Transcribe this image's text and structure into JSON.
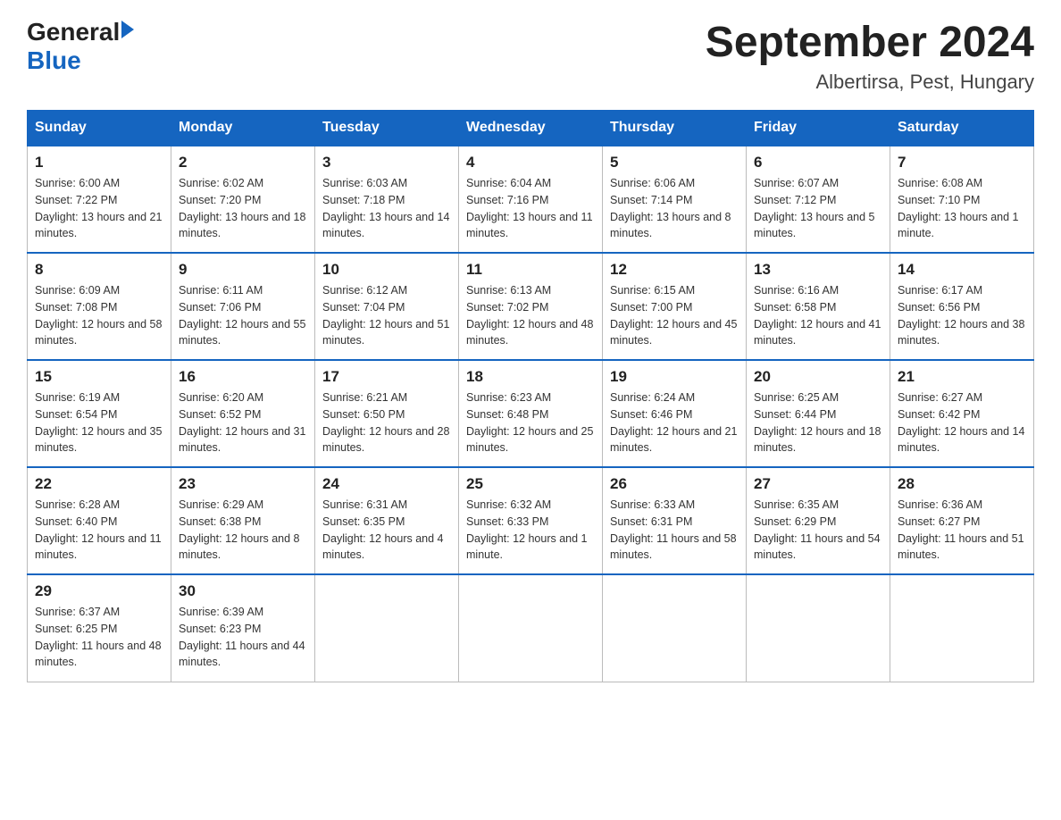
{
  "header": {
    "logo_general": "General",
    "logo_blue": "Blue",
    "title": "September 2024",
    "subtitle": "Albertirsa, Pest, Hungary"
  },
  "weekdays": [
    "Sunday",
    "Monday",
    "Tuesday",
    "Wednesday",
    "Thursday",
    "Friday",
    "Saturday"
  ],
  "weeks": [
    [
      {
        "day": "1",
        "sunrise": "6:00 AM",
        "sunset": "7:22 PM",
        "daylight": "13 hours and 21 minutes."
      },
      {
        "day": "2",
        "sunrise": "6:02 AM",
        "sunset": "7:20 PM",
        "daylight": "13 hours and 18 minutes."
      },
      {
        "day": "3",
        "sunrise": "6:03 AM",
        "sunset": "7:18 PM",
        "daylight": "13 hours and 14 minutes."
      },
      {
        "day": "4",
        "sunrise": "6:04 AM",
        "sunset": "7:16 PM",
        "daylight": "13 hours and 11 minutes."
      },
      {
        "day": "5",
        "sunrise": "6:06 AM",
        "sunset": "7:14 PM",
        "daylight": "13 hours and 8 minutes."
      },
      {
        "day": "6",
        "sunrise": "6:07 AM",
        "sunset": "7:12 PM",
        "daylight": "13 hours and 5 minutes."
      },
      {
        "day": "7",
        "sunrise": "6:08 AM",
        "sunset": "7:10 PM",
        "daylight": "13 hours and 1 minute."
      }
    ],
    [
      {
        "day": "8",
        "sunrise": "6:09 AM",
        "sunset": "7:08 PM",
        "daylight": "12 hours and 58 minutes."
      },
      {
        "day": "9",
        "sunrise": "6:11 AM",
        "sunset": "7:06 PM",
        "daylight": "12 hours and 55 minutes."
      },
      {
        "day": "10",
        "sunrise": "6:12 AM",
        "sunset": "7:04 PM",
        "daylight": "12 hours and 51 minutes."
      },
      {
        "day": "11",
        "sunrise": "6:13 AM",
        "sunset": "7:02 PM",
        "daylight": "12 hours and 48 minutes."
      },
      {
        "day": "12",
        "sunrise": "6:15 AM",
        "sunset": "7:00 PM",
        "daylight": "12 hours and 45 minutes."
      },
      {
        "day": "13",
        "sunrise": "6:16 AM",
        "sunset": "6:58 PM",
        "daylight": "12 hours and 41 minutes."
      },
      {
        "day": "14",
        "sunrise": "6:17 AM",
        "sunset": "6:56 PM",
        "daylight": "12 hours and 38 minutes."
      }
    ],
    [
      {
        "day": "15",
        "sunrise": "6:19 AM",
        "sunset": "6:54 PM",
        "daylight": "12 hours and 35 minutes."
      },
      {
        "day": "16",
        "sunrise": "6:20 AM",
        "sunset": "6:52 PM",
        "daylight": "12 hours and 31 minutes."
      },
      {
        "day": "17",
        "sunrise": "6:21 AM",
        "sunset": "6:50 PM",
        "daylight": "12 hours and 28 minutes."
      },
      {
        "day": "18",
        "sunrise": "6:23 AM",
        "sunset": "6:48 PM",
        "daylight": "12 hours and 25 minutes."
      },
      {
        "day": "19",
        "sunrise": "6:24 AM",
        "sunset": "6:46 PM",
        "daylight": "12 hours and 21 minutes."
      },
      {
        "day": "20",
        "sunrise": "6:25 AM",
        "sunset": "6:44 PM",
        "daylight": "12 hours and 18 minutes."
      },
      {
        "day": "21",
        "sunrise": "6:27 AM",
        "sunset": "6:42 PM",
        "daylight": "12 hours and 14 minutes."
      }
    ],
    [
      {
        "day": "22",
        "sunrise": "6:28 AM",
        "sunset": "6:40 PM",
        "daylight": "12 hours and 11 minutes."
      },
      {
        "day": "23",
        "sunrise": "6:29 AM",
        "sunset": "6:38 PM",
        "daylight": "12 hours and 8 minutes."
      },
      {
        "day": "24",
        "sunrise": "6:31 AM",
        "sunset": "6:35 PM",
        "daylight": "12 hours and 4 minutes."
      },
      {
        "day": "25",
        "sunrise": "6:32 AM",
        "sunset": "6:33 PM",
        "daylight": "12 hours and 1 minute."
      },
      {
        "day": "26",
        "sunrise": "6:33 AM",
        "sunset": "6:31 PM",
        "daylight": "11 hours and 58 minutes."
      },
      {
        "day": "27",
        "sunrise": "6:35 AM",
        "sunset": "6:29 PM",
        "daylight": "11 hours and 54 minutes."
      },
      {
        "day": "28",
        "sunrise": "6:36 AM",
        "sunset": "6:27 PM",
        "daylight": "11 hours and 51 minutes."
      }
    ],
    [
      {
        "day": "29",
        "sunrise": "6:37 AM",
        "sunset": "6:25 PM",
        "daylight": "11 hours and 48 minutes."
      },
      {
        "day": "30",
        "sunrise": "6:39 AM",
        "sunset": "6:23 PM",
        "daylight": "11 hours and 44 minutes."
      },
      null,
      null,
      null,
      null,
      null
    ]
  ]
}
